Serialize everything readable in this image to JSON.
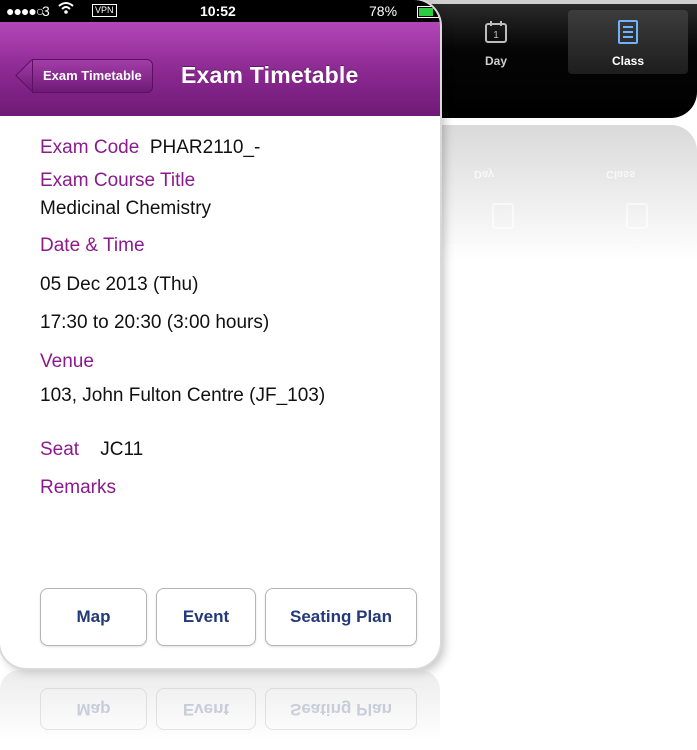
{
  "back_phone": {
    "tabs": [
      {
        "label": "",
        "icon": "calendar-icon"
      },
      {
        "label": "Day",
        "icon": "calendar-day-icon",
        "day_number": "1"
      },
      {
        "label": "Class",
        "icon": "list-icon",
        "selected": true
      }
    ]
  },
  "status_bar": {
    "signal": "●●●●○",
    "carrier": "3",
    "vpn": "VPN",
    "time": "10:52",
    "battery": "78%",
    "battery_level": 0.78
  },
  "nav": {
    "back_label": "Exam Timetable",
    "title": "Exam Timetable"
  },
  "exam": {
    "code_label": "Exam Code",
    "code": "PHAR2110_-",
    "course_title_label": "Exam Course Title",
    "course_title": "Medicinal Chemistry",
    "datetime_label": "Date & Time",
    "date": "05 Dec 2013 (Thu)",
    "time": "17:30 to 20:30 (3:00 hours)",
    "venue_label": "Venue",
    "venue": "103, John Fulton Centre (JF_103)",
    "seat_label": "Seat",
    "seat": "JC11",
    "remarks_label": "Remarks"
  },
  "actions": {
    "map": "Map",
    "event": "Event",
    "seating_plan": "Seating Plan"
  },
  "colors": {
    "accent": "#8b1a8d",
    "button_text": "#243a78"
  }
}
